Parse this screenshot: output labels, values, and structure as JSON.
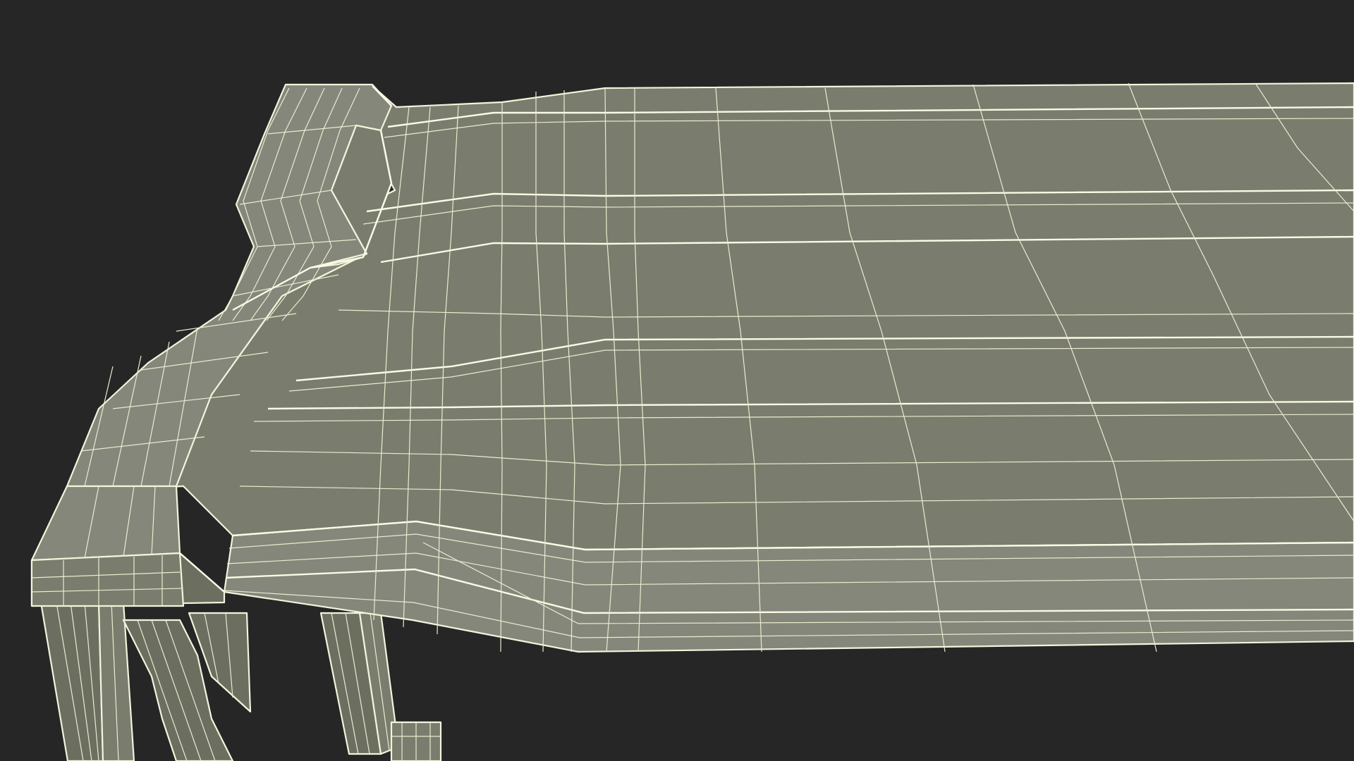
{
  "scene": {
    "subject": "table-wireframe-render",
    "colors": {
      "background": "#262626",
      "surface": "#7a7d6d",
      "surface_dark": "#6c6f60",
      "wireframe": "#f4f3dc"
    }
  }
}
